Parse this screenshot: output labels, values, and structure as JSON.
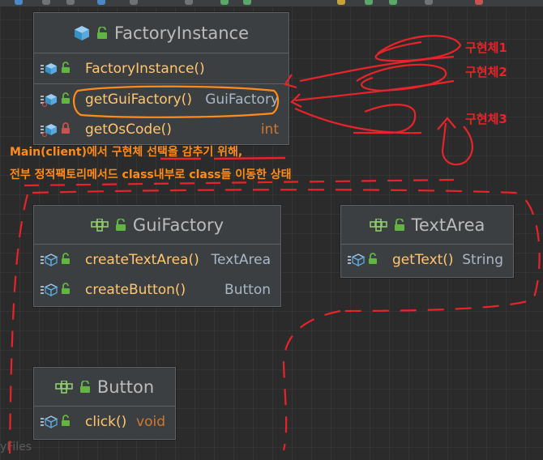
{
  "classes": {
    "factory_instance": {
      "title": "FactoryInstance",
      "members": [
        {
          "name": "FactoryInstance()",
          "type": ""
        },
        {
          "name": "getGuiFactory()",
          "type": "GuiFactory"
        },
        {
          "name": "getOsCode()",
          "type": "int"
        }
      ]
    },
    "gui_factory": {
      "title": "GuiFactory",
      "members": [
        {
          "name": "createTextArea()",
          "type": "TextArea"
        },
        {
          "name": "createButton()",
          "type": "Button"
        }
      ]
    },
    "text_area": {
      "title": "TextArea",
      "members": [
        {
          "name": "getText()",
          "type": "String"
        }
      ]
    },
    "button": {
      "title": "Button",
      "members": [
        {
          "name": "click()",
          "type": "void"
        }
      ]
    }
  },
  "notes": {
    "line1": "Main(client)에서 구현체 선택을 감추기 위해,",
    "line2": "전부 정적팩토리메서드 class내부로  class들 이동한 상태"
  },
  "annotations": {
    "impl1": "구현체1",
    "impl2": "구현체2",
    "impl3": "구현체3"
  },
  "watermark": "yFiles",
  "colors": {
    "background": "#2b2b2b",
    "node": "#3c3f41",
    "method": "#ffc66d",
    "type": "#a9b7c6",
    "keyword": "#cc7832",
    "note": "#ff8c1a",
    "annotation": "#e8242a",
    "highlight": "#ff8c1a"
  },
  "icons": {
    "interface": "blue-cube-icon",
    "class": "green-class-icon",
    "method": "method-icon",
    "public": "unlock-icon",
    "private": "lock-icon"
  }
}
